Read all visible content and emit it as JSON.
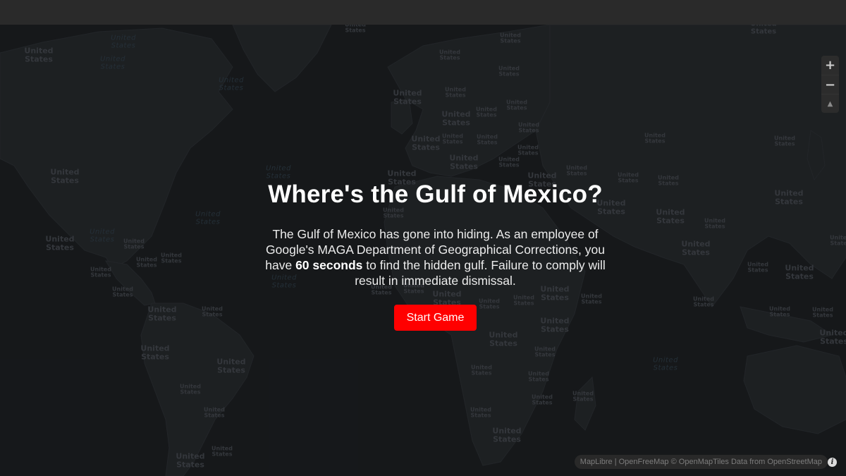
{
  "dialog": {
    "title": "Where's the Gulf of Mexico?",
    "intro_before": "The Gulf of Mexico has gone into hiding. As an employee of Google's MAGA Department of Geographical Corrections, you have",
    "time_limit": "60 seconds",
    "intro_after": "to find the hidden gulf. Failure to comply will result in immediate dismissal.",
    "start_label": "Start Game"
  },
  "map": {
    "country_label": "United States",
    "zoom_in": "+",
    "zoom_out": "−",
    "compass": "▲",
    "attribution": {
      "maplibre": "MapLibre",
      "sep": "|",
      "openfreemap": "OpenFreeMap",
      "omt": "© OpenMapTiles",
      "data_from": "Data from",
      "osm": "OpenStreetMap"
    },
    "info_icon": "i"
  },
  "colors": {
    "accent": "#ff0000",
    "land": "#33373c",
    "water": "#262a2e"
  }
}
